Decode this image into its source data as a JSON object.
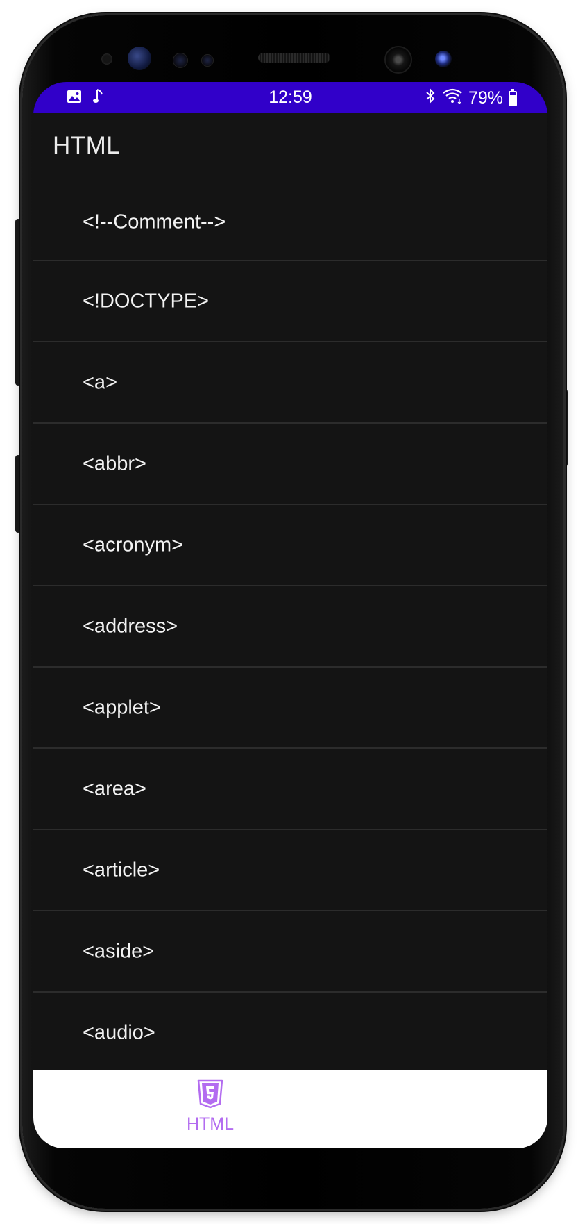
{
  "status_bar": {
    "time": "12:59",
    "battery": "79%",
    "left_icons": [
      "gallery-icon",
      "music-icon"
    ],
    "right_icons": [
      "bluetooth-icon",
      "wifi-icon",
      "battery-icon"
    ],
    "background_color": "#3100c9"
  },
  "app_bar": {
    "title": "HTML"
  },
  "list": {
    "items": [
      {
        "label": "<!--Comment-->"
      },
      {
        "label": "<!DOCTYPE>"
      },
      {
        "label": "<a>"
      },
      {
        "label": "<abbr>"
      },
      {
        "label": "<acronym>"
      },
      {
        "label": "<address>"
      },
      {
        "label": "<applet>"
      },
      {
        "label": "<area>"
      },
      {
        "label": "<article>"
      },
      {
        "label": "<aside>"
      },
      {
        "label": "<audio>"
      }
    ]
  },
  "bottom_nav": {
    "items": [
      {
        "label": "HTML",
        "icon": "html5-icon",
        "active": true
      }
    ],
    "accent_color": "#b36cf0"
  }
}
